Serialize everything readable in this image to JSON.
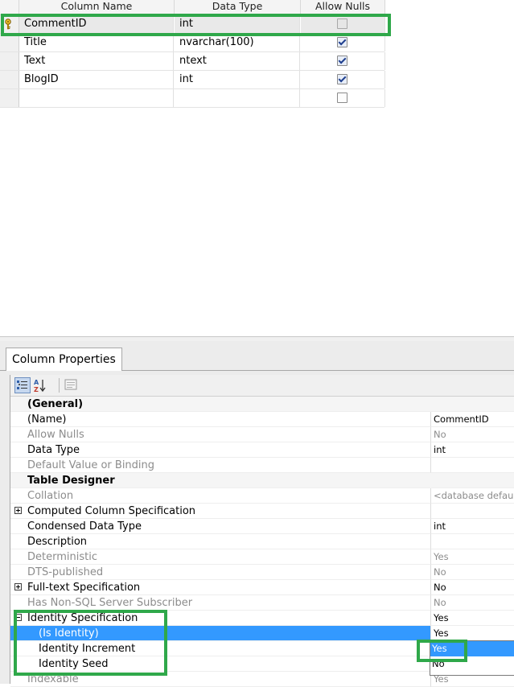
{
  "grid": {
    "headers": {
      "name": "Column Name",
      "type": "Data Type",
      "nulls": "Allow Nulls"
    },
    "rows": [
      {
        "name": "CommentID",
        "type": "int",
        "allow_nulls": false,
        "primary_key": true
      },
      {
        "name": "Title",
        "type": "nvarchar(100)",
        "allow_nulls": true
      },
      {
        "name": "Text",
        "type": "ntext",
        "allow_nulls": true
      },
      {
        "name": "BlogID",
        "type": "int",
        "allow_nulls": true
      },
      {
        "name": "",
        "type": "",
        "allow_nulls": false
      }
    ]
  },
  "panel": {
    "tab_label": "Column Properties",
    "toolbar": {
      "categorized_icon": "categorized-icon",
      "alphabetical_icon": "alphabetical-sort-icon",
      "property_pages_icon": "property-pages-icon"
    },
    "properties": [
      {
        "name": "(General)",
        "value": "",
        "category": true,
        "expand": "minus"
      },
      {
        "name": "(Name)",
        "value": "CommentID"
      },
      {
        "name": "Allow Nulls",
        "value": "No",
        "dim": true
      },
      {
        "name": "Data Type",
        "value": "int"
      },
      {
        "name": "Default Value or Binding",
        "value": "",
        "dim": true
      },
      {
        "name": "Table Designer",
        "value": "",
        "category": true,
        "expand": "minus"
      },
      {
        "name": "Collation",
        "value": "<database default>",
        "dim": true
      },
      {
        "name": "Computed Column Specification",
        "value": "",
        "expand": "plus"
      },
      {
        "name": "Condensed Data Type",
        "value": "int"
      },
      {
        "name": "Description",
        "value": ""
      },
      {
        "name": "Deterministic",
        "value": "Yes",
        "dim": true
      },
      {
        "name": "DTS-published",
        "value": "No",
        "dim": true
      },
      {
        "name": "Full-text Specification",
        "value": "No",
        "expand": "plus"
      },
      {
        "name": "Has Non-SQL Server Subscriber",
        "value": "No",
        "dim": true
      },
      {
        "name": "Identity Specification",
        "value": "Yes",
        "expand": "minus"
      },
      {
        "name": "(Is Identity)",
        "value": "Yes",
        "sub": true,
        "selected": true
      },
      {
        "name": "Identity Increment",
        "value": "",
        "sub": true
      },
      {
        "name": "Identity Seed",
        "value": "",
        "sub": true
      },
      {
        "name": "Indexable",
        "value": "Yes",
        "dim": true
      }
    ],
    "dropdown": {
      "options": [
        "Yes",
        "No"
      ],
      "selected": "Yes"
    }
  }
}
